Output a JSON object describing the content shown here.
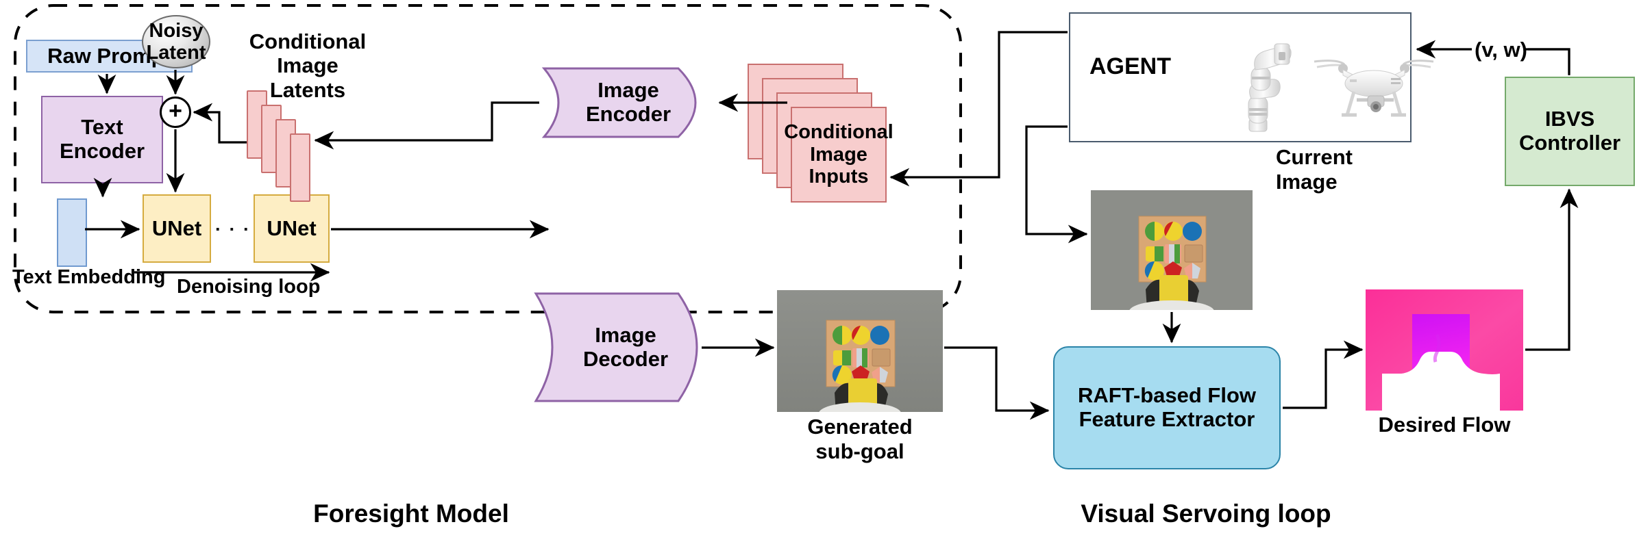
{
  "diagram": {
    "title_left": "Foresight Model",
    "title_right": "Visual Servoing loop",
    "nodes": {
      "raw_prompt": "Raw Prompt",
      "text_encoder": "Text Encoder",
      "text_embedding": "Text Embedding",
      "noisy_latent": "Noisy Latent",
      "plus": "+",
      "unet_1": "UNet",
      "unet_2": "UNet",
      "ellipsis": "· · · · ·",
      "denoising_loop": "Denoising loop",
      "cond_image_latents": "Conditional Image Latents",
      "image_encoder": "Image Encoder",
      "cond_image_inputs": "Conditional Image Inputs",
      "image_decoder": "Image Decoder",
      "generated_subgoal": "Generated sub-goal",
      "agent": "AGENT",
      "current_image": "Current Image",
      "raft": "RAFT-based Flow Feature Extractor",
      "desired_flow": "Desired Flow",
      "ibvs": "IBVS Controller",
      "velocity_signal": "(v, w)"
    },
    "colors": {
      "prompt_fill": "#d6e4f7",
      "prompt_stroke": "#7b9fd0",
      "encoder_fill": "#e8d5ee",
      "encoder_stroke": "#8e62a5",
      "unet_fill": "#fdeec4",
      "unet_stroke": "#d5ab3f",
      "cond_fill": "#f7cdcd",
      "cond_stroke": "#c9706f",
      "raft_fill": "#a6dcf0",
      "raft_stroke": "#2b84a8",
      "ibvs_fill": "#d5ead0",
      "ibvs_stroke": "#74a96a",
      "agent_stroke": "#4a5b6e",
      "flow_pink": "#fb3fa0",
      "flow_magenta": "#e022f0",
      "line": "#000000"
    }
  }
}
